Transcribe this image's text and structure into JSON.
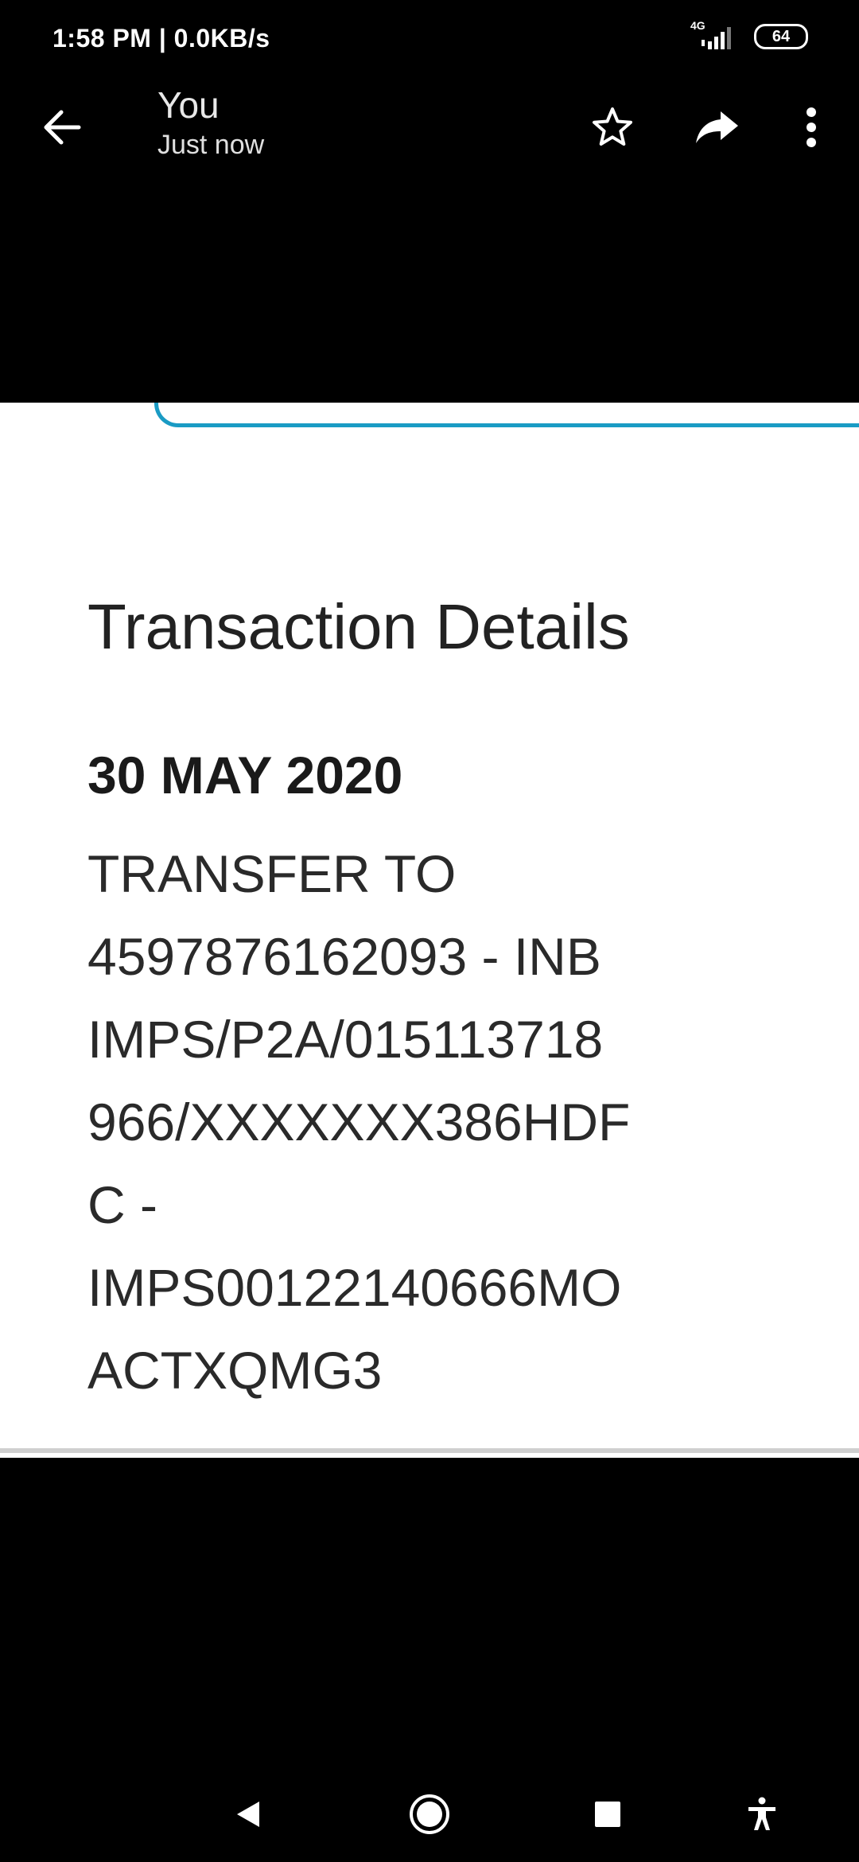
{
  "status_bar": {
    "time_speed": "1:58 PM | 0.0KB/s",
    "network_label": "4G",
    "battery_level": "64"
  },
  "app_bar": {
    "title": "You",
    "subtitle": "Just now",
    "icons": [
      "back-arrow-icon",
      "star-icon",
      "forward-icon",
      "more-vertical-icon"
    ]
  },
  "document": {
    "heading": "Transaction Details",
    "date": "30 MAY 2020",
    "lines": [
      "TRANSFER TO",
      "4597876162093 - INB",
      "IMPS/P2A/015113718",
      "966/XXXXXXX386HDF",
      "C -",
      "IMPS00122140666MO",
      "ACTXQMG3"
    ],
    "accent_color": "#1a9bc4"
  },
  "nav_bar": {
    "icons": [
      "back-triangle-icon",
      "home-circle-icon",
      "recents-square-icon",
      "accessibility-icon"
    ]
  }
}
